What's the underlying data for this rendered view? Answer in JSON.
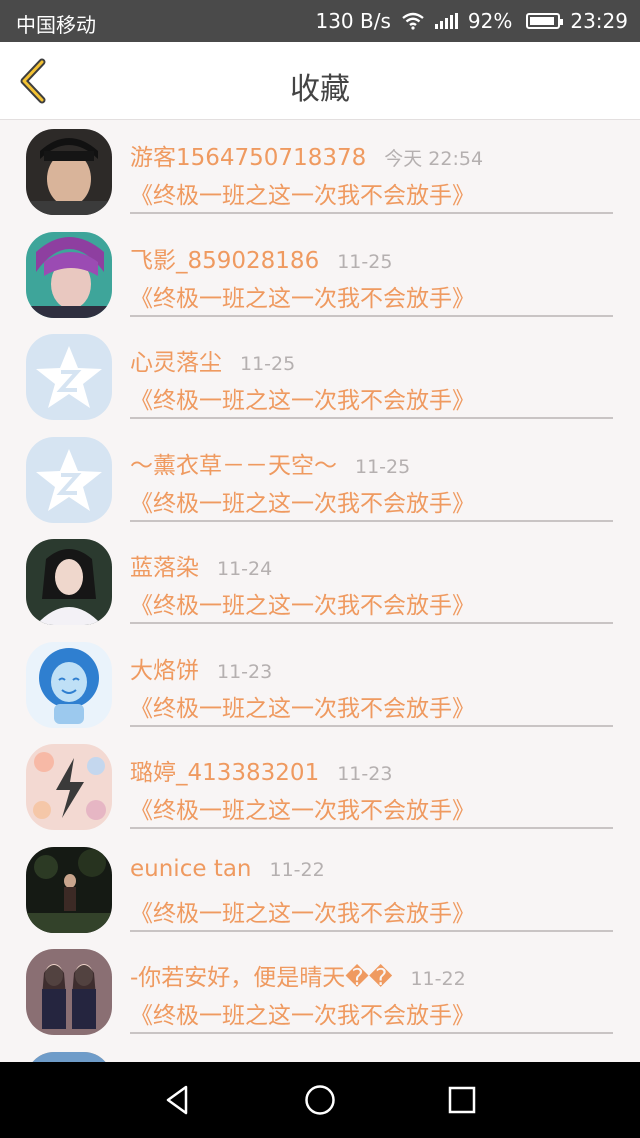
{
  "status_bar": {
    "carrier": "中国移动",
    "speed": "130 B/s",
    "battery": "92%",
    "battery_level": 0.92,
    "time": "23:29"
  },
  "header": {
    "title": "收藏"
  },
  "favorites": [
    {
      "name": "游客1564750718378",
      "time": "今天 22:54",
      "book": "《终极一班之这一次我不会放手》"
    },
    {
      "name": "飞影_859028186",
      "time": "11-25",
      "book": "《终极一班之这一次我不会放手》"
    },
    {
      "name": "心灵落尘",
      "time": "11-25",
      "book": "《终极一班之这一次我不会放手》"
    },
    {
      "name": "～薰衣草－－天空～",
      "time": "11-25",
      "book": "《终极一班之这一次我不会放手》"
    },
    {
      "name": "蓝落染",
      "time": "11-24",
      "book": "《终极一班之这一次我不会放手》"
    },
    {
      "name": "大烙饼",
      "time": "11-23",
      "book": "《终极一班之这一次我不会放手》"
    },
    {
      "name": "璐婷_413383201",
      "time": "11-23",
      "book": "《终极一班之这一次我不会放手》"
    },
    {
      "name": "eunice tan",
      "time": "11-22",
      "book": "《终极一班之这一次我不会放手》"
    },
    {
      "name": "-你若安好，便是晴天��",
      "time": "11-22",
      "book": "《终极一班之这一次我不会放手》"
    }
  ],
  "colors": {
    "accent": "#ef9a60",
    "time_gray": "#b5b0b0",
    "background": "#f8f5f5"
  }
}
